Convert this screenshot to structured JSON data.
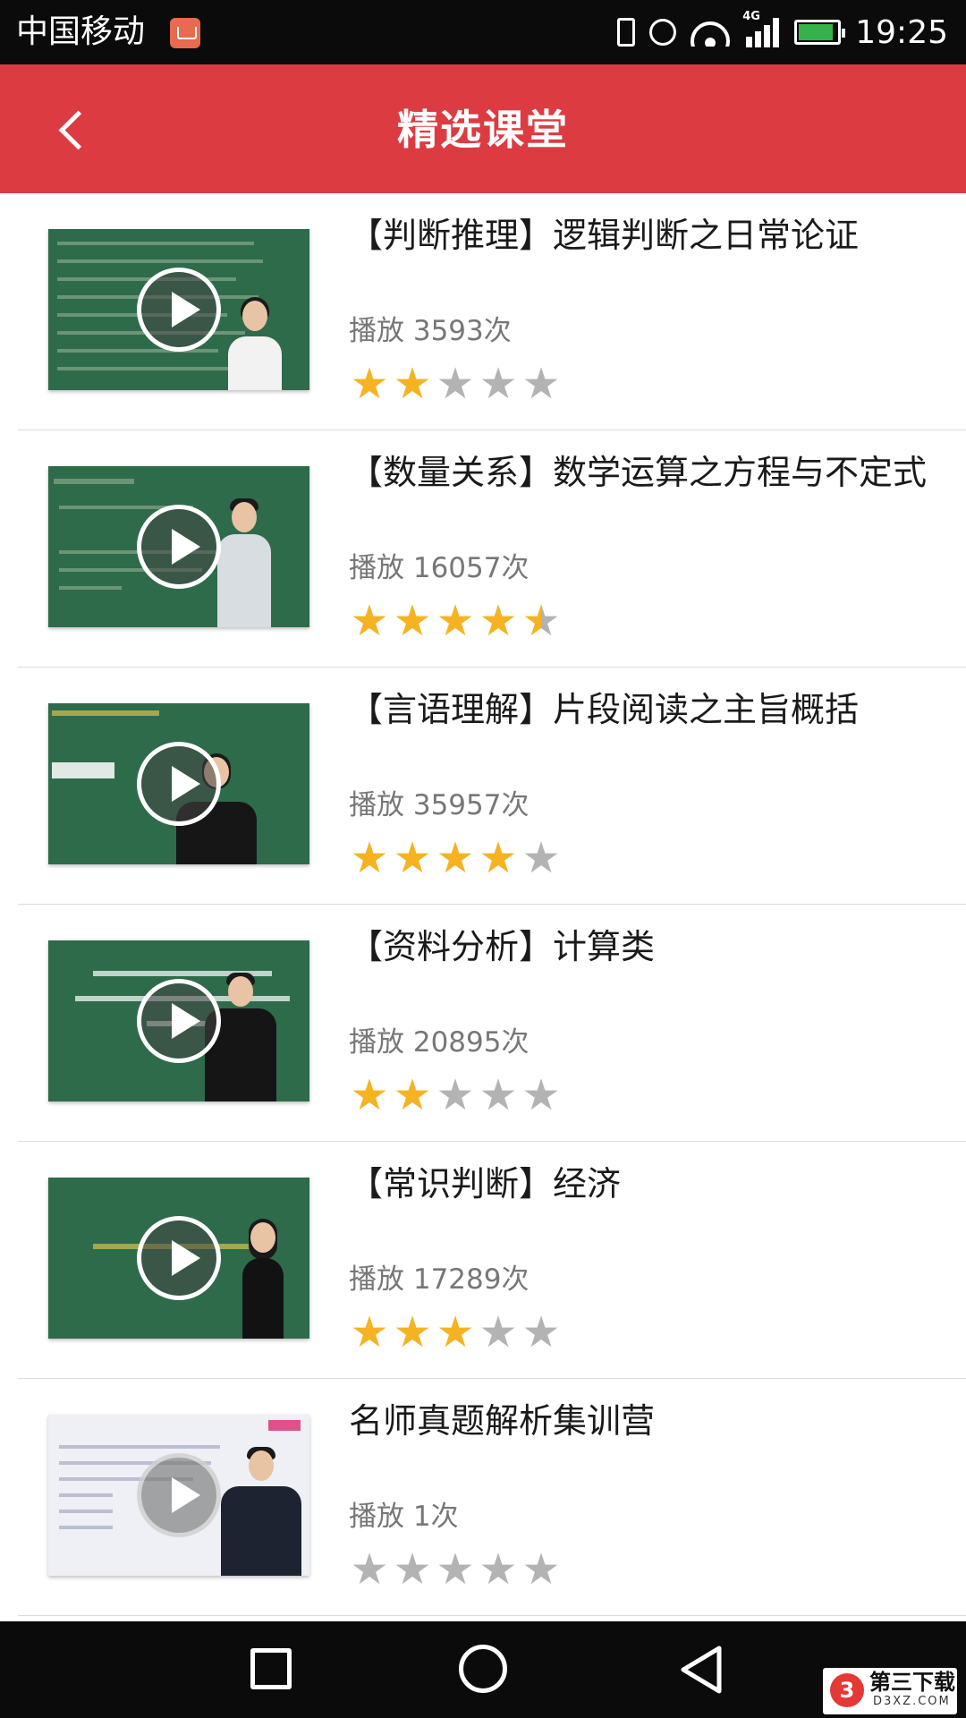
{
  "status_bar": {
    "carrier": "中国移动",
    "network_type": "4G",
    "time": "19:25",
    "battery_level": 0.9,
    "icons": [
      "notification-icon",
      "vibrate-icon",
      "alarm-icon",
      "wifi-icon",
      "signal-icon",
      "battery-icon"
    ]
  },
  "header": {
    "title": "精选课堂",
    "background_color": "#dc3b42",
    "back_icon": "chevron-left-icon"
  },
  "courses": [
    {
      "title": "【判断推理】逻辑判断之日常论证",
      "plays": "播放 3593次",
      "rating": 2
    },
    {
      "title": "【数量关系】数学运算之方程与不定式",
      "plays": "播放 16057次",
      "rating": 4.5
    },
    {
      "title": "【言语理解】片段阅读之主旨概括",
      "plays": "播放 35957次",
      "rating": 4
    },
    {
      "title": "【资料分析】计算类",
      "plays": "播放 20895次",
      "rating": 2
    },
    {
      "title": "【常识判断】经济",
      "plays": "播放 17289次",
      "rating": 3
    },
    {
      "title": "名师真题解析集训营",
      "plays": "播放 1次",
      "rating": 0
    }
  ],
  "rating_max": 5,
  "star_color": "#f5b324",
  "nav_bar": {
    "icons": [
      "recent-apps-icon",
      "home-icon",
      "back-nav-icon"
    ]
  },
  "watermark": {
    "logo": "3",
    "name": "第三下载",
    "domain": "D3XZ.COM"
  }
}
